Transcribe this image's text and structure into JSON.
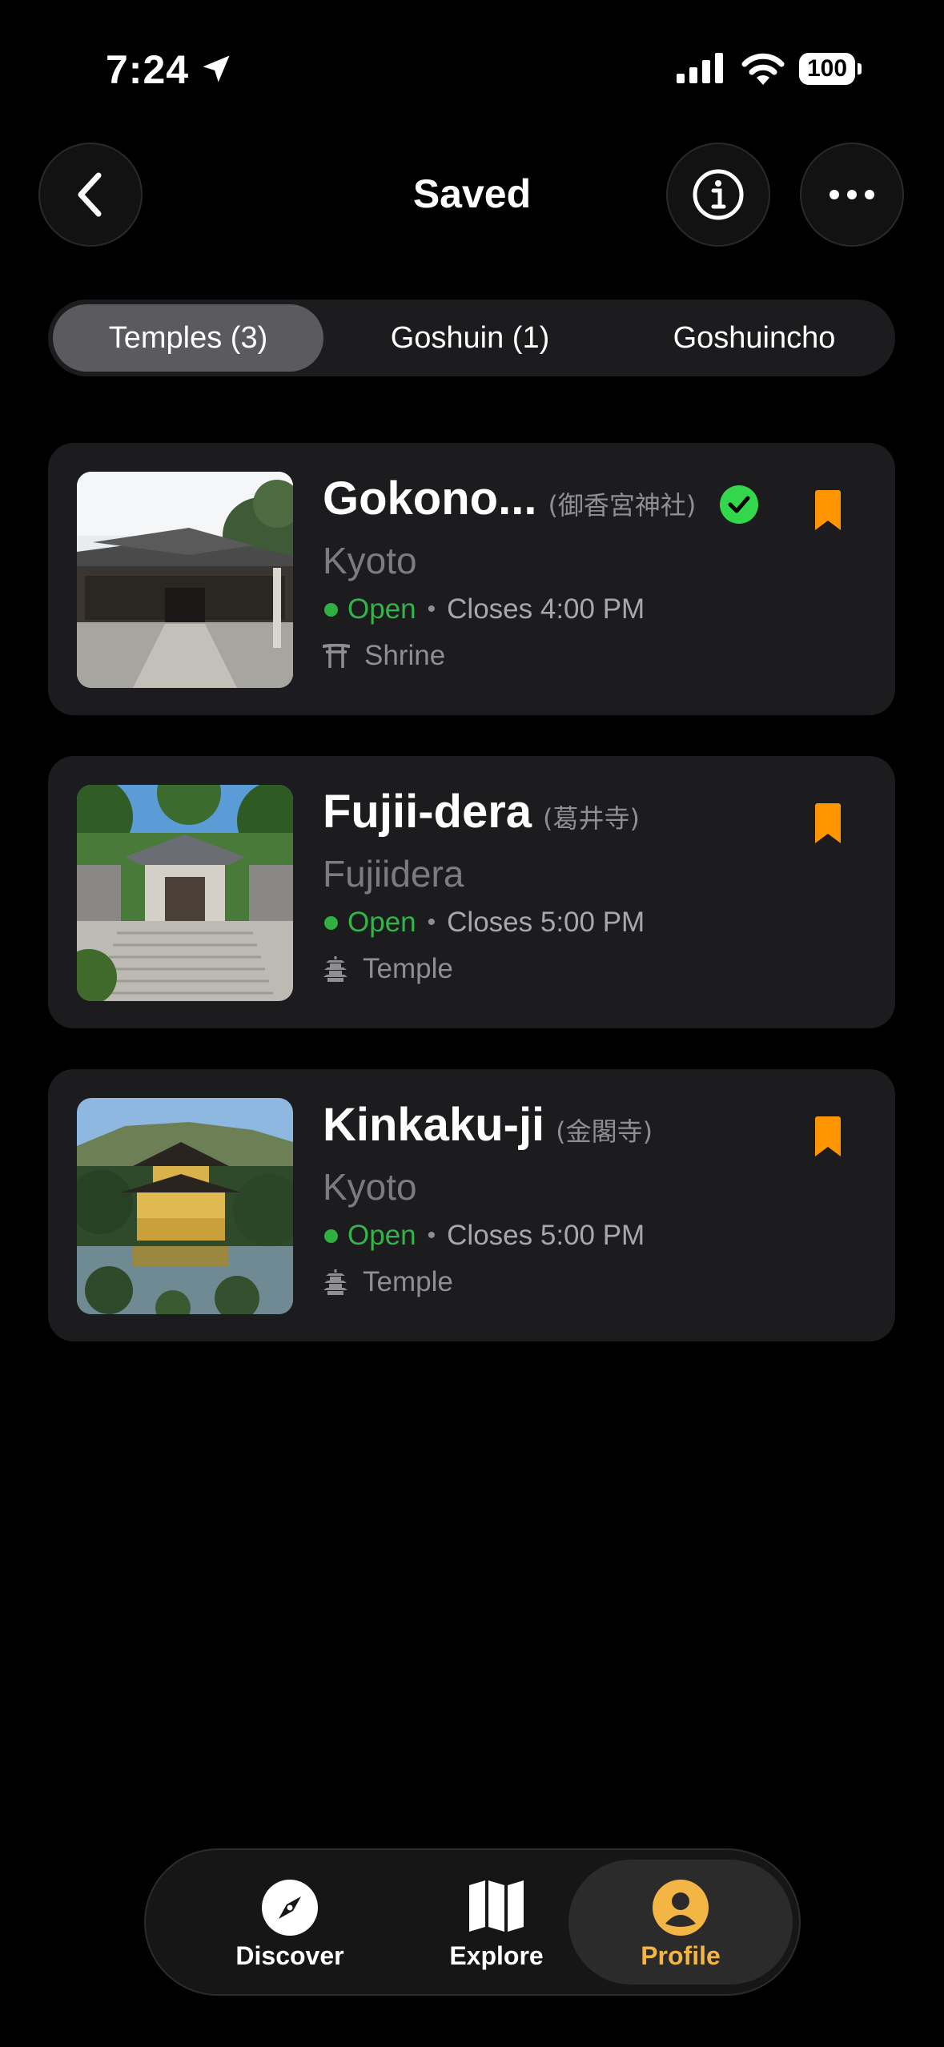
{
  "status_bar": {
    "time": "7:24",
    "battery": "100"
  },
  "header": {
    "title": "Saved"
  },
  "segments": [
    {
      "label": "Temples (3)",
      "active": true
    },
    {
      "label": "Goshuin (1)",
      "active": false
    },
    {
      "label": "Goshuincho",
      "active": false
    }
  ],
  "places": [
    {
      "name": "Gokono...",
      "japanese": "(御香宮神社)",
      "city": "Kyoto",
      "open": "Open",
      "closes": "Closes 4:00 PM",
      "type": "Shrine",
      "visited": true,
      "saved": true
    },
    {
      "name": "Fujii-dera",
      "japanese": "(葛井寺)",
      "city": "Fujiidera",
      "open": "Open",
      "closes": "Closes 5:00 PM",
      "type": "Temple",
      "visited": false,
      "saved": true
    },
    {
      "name": "Kinkaku-ji",
      "japanese": "(金閣寺)",
      "city": "Kyoto",
      "open": "Open",
      "closes": "Closes 5:00 PM",
      "type": "Temple",
      "visited": false,
      "saved": true
    }
  ],
  "tabbar": [
    {
      "label": "Discover",
      "icon": "compass-icon",
      "active": false
    },
    {
      "label": "Explore",
      "icon": "map-icon",
      "active": false
    },
    {
      "label": "Profile",
      "icon": "person-icon",
      "active": true
    }
  ],
  "colors": {
    "accent": "#f3b544",
    "bookmark": "#ff9500",
    "open": "#34b34a",
    "verified": "#32d74b"
  }
}
